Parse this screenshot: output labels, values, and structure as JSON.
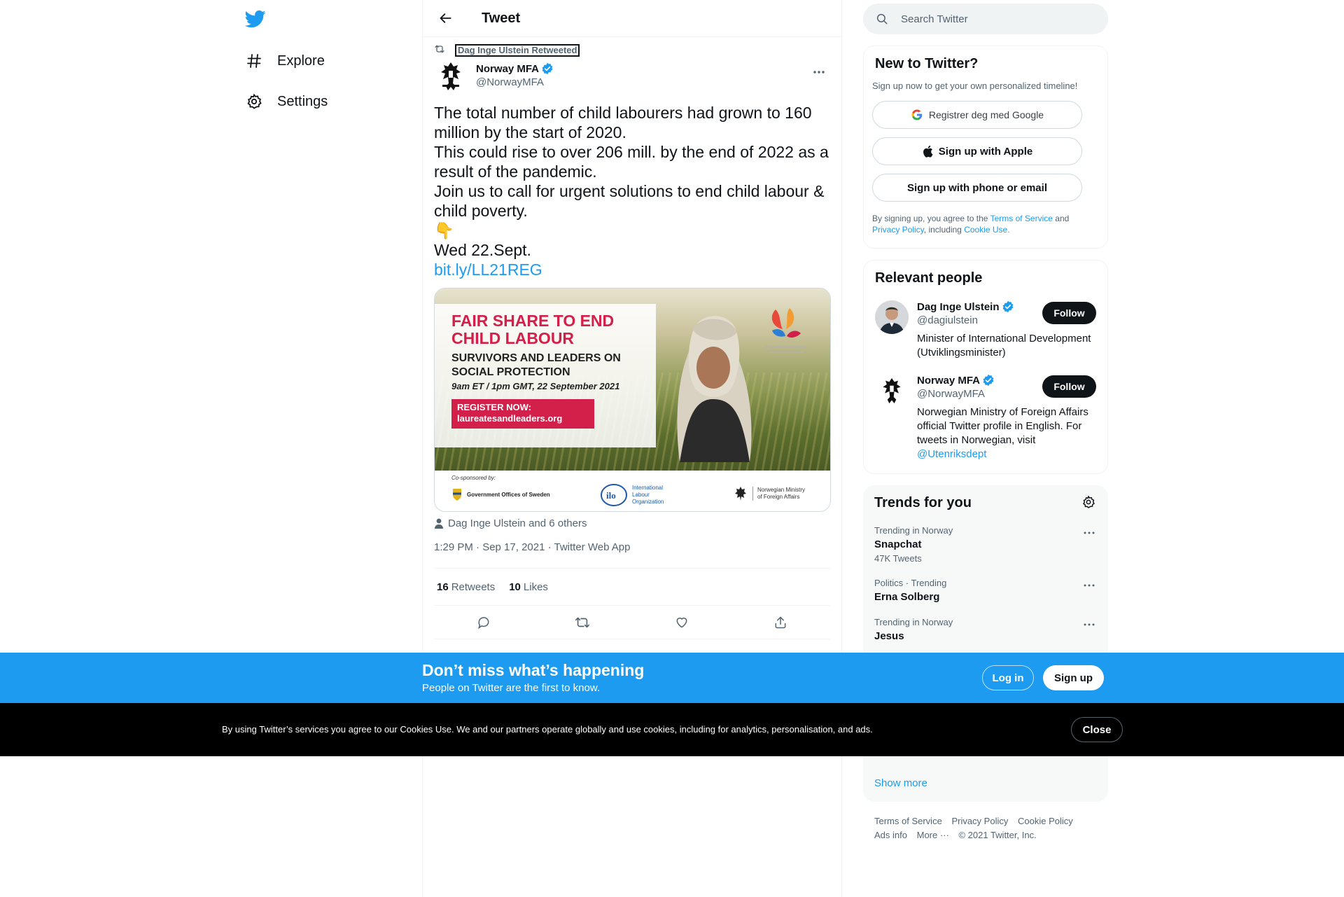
{
  "colors": {
    "brand": "#1d9bf0",
    "text": "#0f1419",
    "muted": "#536471",
    "border": "#eff3f4",
    "cookie_bg": "#000000"
  },
  "nav": {
    "items": [
      {
        "label": "Explore",
        "icon": "hashtag-icon"
      },
      {
        "label": "Settings",
        "icon": "gear-icon"
      }
    ]
  },
  "header": {
    "title": "Tweet"
  },
  "tweet": {
    "retweeted_by": "Dag Inge Ulstein Retweeted",
    "author_name": "Norway MFA",
    "author_handle": "@NorwayMFA",
    "text_lines": [
      "The total number of child labourers had grown to 160 million by the start of 2020.",
      "This could rise to over 206 mill. by the end of 2022 as a result of the pandemic.",
      "Join us to call for urgent solutions to end child labour & child poverty.",
      "👇",
      "Wed 22.Sept."
    ],
    "link": "bit.ly/LL21REG",
    "media": {
      "headline": "FAIR SHARE TO END CHILD LABOUR",
      "subheadline": "SURVIVORS AND LEADERS ON SOCIAL PROTECTION",
      "time": "9am ET / 1pm GMT, 22 September 2021",
      "register": "REGISTER NOW:",
      "register_url": "laureatesandleaders.org",
      "cosponsored": "Co-sponsored by:",
      "sponsor_1": "Government Offices of Sweden",
      "sponsor_2": "International Labour Organization",
      "sponsor_3": "Norwegian Ministry of Foreign Affairs"
    },
    "tagged": "Dag Inge Ulstein and 6 others",
    "meta": "1:29 PM · Sep 17, 2021 · Twitter Web App",
    "retweets_count": "16",
    "retweets_label": "Retweets",
    "likes_count": "10",
    "likes_label": "Likes"
  },
  "search": {
    "placeholder": "Search Twitter"
  },
  "new_to_twitter": {
    "title": "New to Twitter?",
    "subtitle": "Sign up now to get your own personalized timeline!",
    "google_label": "Registrer deg med Google",
    "apple_label": "Sign up with Apple",
    "phone_label": "Sign up with phone or email",
    "terms_prefix": "By signing up, you agree to the",
    "terms_link": "Terms of Service",
    "terms_and": "and",
    "privacy_link": "Privacy Policy",
    "including": ", including",
    "cookie_link": "Cookie Use."
  },
  "relevant_people": {
    "title": "Relevant people",
    "people": [
      {
        "name": "Dag Inge Ulstein",
        "handle": "@dagiulstein",
        "bio": "Minister of International Development (Utviklingsminister)",
        "mention": "",
        "follow": "Follow"
      },
      {
        "name": "Norway MFA",
        "handle": "@NorwayMFA",
        "bio": "Norwegian Ministry of Foreign Affairs official Twitter profile in English. For tweets in Norwegian, visit",
        "mention": "@Utenriksdept",
        "follow": "Follow"
      }
    ]
  },
  "trends": {
    "title": "Trends for you",
    "items": [
      {
        "context": "Trending in Norway",
        "name": "Snapchat",
        "count": "47K Tweets"
      },
      {
        "context": "Politics · Trending",
        "name": "Erna Solberg",
        "count": ""
      },
      {
        "context": "Trending in Norway",
        "name": "Jesus",
        "count": ""
      }
    ],
    "show_more": "Show more"
  },
  "footer": {
    "links": [
      "Terms of Service",
      "Privacy Policy",
      "Cookie Policy",
      "Ads info",
      "More ···"
    ],
    "copyright": "© 2021 Twitter, Inc."
  },
  "signup_banner": {
    "title": "Don’t miss what’s happening",
    "subtitle": "People on Twitter are the first to know.",
    "login": "Log in",
    "signup": "Sign up"
  },
  "cookie_banner": {
    "text": "By using Twitter’s services you agree to our Cookies Use. We and our partners operate globally and use cookies, including for analytics, personalisation, and ads.",
    "close": "Close"
  }
}
